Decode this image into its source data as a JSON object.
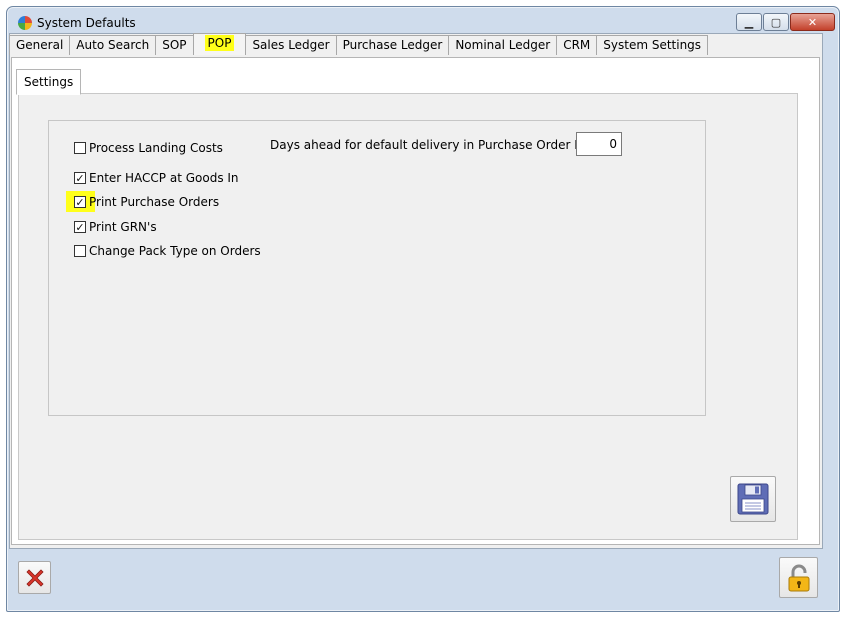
{
  "window": {
    "title": "System Defaults",
    "minimize_glyph": "▁",
    "maximize_glyph": "▢",
    "close_glyph": "✕"
  },
  "tabs": [
    {
      "label": "General"
    },
    {
      "label": "Auto Search"
    },
    {
      "label": "SOP"
    },
    {
      "label": "POP",
      "active": true,
      "highlighted": true
    },
    {
      "label": "Sales Ledger"
    },
    {
      "label": "Purchase Ledger"
    },
    {
      "label": "Nominal Ledger"
    },
    {
      "label": "CRM"
    },
    {
      "label": "System Settings"
    }
  ],
  "subtabs": [
    {
      "label": "Settings"
    }
  ],
  "settings": {
    "checkboxes": [
      {
        "label": "Process Landing Costs",
        "checked": false,
        "highlighted": false
      },
      {
        "label": "Enter HACCP at Goods In",
        "checked": true,
        "highlighted": false
      },
      {
        "label": "Print Purchase Orders",
        "checked": true,
        "highlighted": true
      },
      {
        "label": "Print GRN's",
        "checked": true,
        "highlighted": false
      },
      {
        "label": "Change Pack Type on Orders",
        "checked": false,
        "highlighted": false
      }
    ],
    "days_ahead_label": "Days ahead for default delivery in Purchase Order Entry",
    "days_ahead_value": "0"
  },
  "icons": {
    "save": "floppy-disk-icon",
    "close": "red-x-icon",
    "lock": "padlock-open-icon"
  },
  "colors": {
    "highlight": "#ffff1a",
    "window_frame": "#cfdcec",
    "close_button": "#c3412b",
    "save_icon": "#5f6db6",
    "close_icon": "#d9352b",
    "lock_icon": "#f3b617"
  }
}
